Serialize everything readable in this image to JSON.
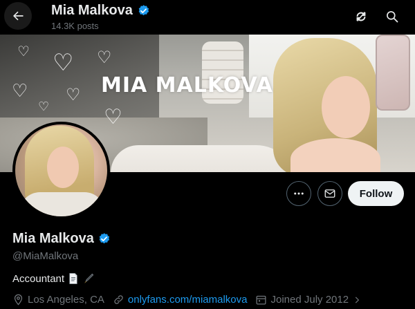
{
  "header": {
    "title": "Mia Malkova",
    "posts": "14.3K posts"
  },
  "banner": {
    "text": "MIA MALKOVA"
  },
  "profile": {
    "name": "Mia Malkova",
    "handle": "@MiaMalkova",
    "bio": "Accountant",
    "location": "Los Angeles, CA",
    "website": "onlyfans.com/miamalkova",
    "joined": "Joined July 2012"
  },
  "actions": {
    "follow": "Follow"
  },
  "colors": {
    "verified": "#1d9bf0",
    "link": "#1d9bf0",
    "muted": "#71767b",
    "text": "#e7e9ea"
  },
  "icons": [
    "back-arrow-icon",
    "verified-badge-icon",
    "refresh-icon",
    "search-icon",
    "more-icon",
    "mail-icon",
    "location-icon",
    "link-icon",
    "calendar-icon",
    "chevron-right-icon"
  ]
}
